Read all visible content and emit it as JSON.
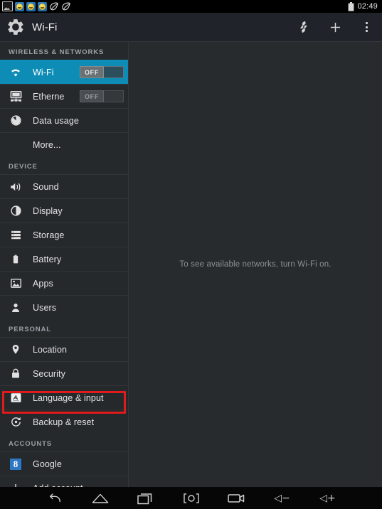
{
  "statusbar": {
    "icons": [
      "screenshot-icon",
      "app-face-icon",
      "app-face-icon",
      "app-face-icon",
      "leaf-icon",
      "leaf-icon"
    ],
    "battery_icon": "battery-icon",
    "time": "02:49"
  },
  "actionbar": {
    "app_icon": "settings-gear-icon",
    "title": "Wi-Fi",
    "actions": [
      {
        "name": "scan-icon",
        "label": "Scan"
      },
      {
        "name": "add-icon",
        "label": "Add network"
      },
      {
        "name": "overflow-menu-icon",
        "label": "More options"
      }
    ]
  },
  "sidebar": {
    "sections": [
      {
        "header": "WIRELESS & NETWORKS",
        "items": [
          {
            "icon": "wifi-icon",
            "label": "Wi-Fi",
            "toggle": "OFF",
            "selected": true
          },
          {
            "icon": "ethernet-icon",
            "label": "Etherne",
            "toggle": "OFF",
            "selected": false
          },
          {
            "icon": "data-usage-icon",
            "label": "Data usage",
            "selected": false
          },
          {
            "icon": "none",
            "label": "More...",
            "selected": false,
            "indent": true
          }
        ]
      },
      {
        "header": "DEVICE",
        "items": [
          {
            "icon": "sound-icon",
            "label": "Sound",
            "selected": false
          },
          {
            "icon": "display-icon",
            "label": "Display",
            "selected": false
          },
          {
            "icon": "storage-icon",
            "label": "Storage",
            "selected": false
          },
          {
            "icon": "battery-icon",
            "label": "Battery",
            "selected": false
          },
          {
            "icon": "apps-icon",
            "label": "Apps",
            "selected": false
          },
          {
            "icon": "users-icon",
            "label": "Users",
            "selected": false
          }
        ]
      },
      {
        "header": "PERSONAL",
        "items": [
          {
            "icon": "location-pin-icon",
            "label": "Location",
            "selected": false
          },
          {
            "icon": "lock-icon",
            "label": "Security",
            "selected": false
          },
          {
            "icon": "language-input-icon",
            "label": "Language & input",
            "selected": false,
            "annotated": true
          },
          {
            "icon": "backup-reset-icon",
            "label": "Backup & reset",
            "selected": false
          }
        ]
      },
      {
        "header": "ACCOUNTS",
        "items": [
          {
            "icon": "google-icon",
            "label": "Google",
            "selected": false
          },
          {
            "icon": "plus-icon",
            "label": "Add account",
            "selected": false
          }
        ]
      }
    ]
  },
  "main": {
    "message": "To see available networks, turn Wi-Fi on."
  },
  "navbar": {
    "buttons": [
      {
        "name": "back-button",
        "label": "Back"
      },
      {
        "name": "home-button",
        "label": "Home"
      },
      {
        "name": "recents-button",
        "label": "Recent apps"
      },
      {
        "name": "screenshot-button",
        "label": "[O]"
      },
      {
        "name": "record-button",
        "label": "Record"
      },
      {
        "name": "volume-down-button",
        "label": "◁−"
      },
      {
        "name": "volume-up-button",
        "label": "◁+"
      }
    ]
  },
  "colors": {
    "accent": "#0d8cb6",
    "annotation": "#e01b1b",
    "background": "#26292c",
    "actionbar": "#20232a"
  }
}
